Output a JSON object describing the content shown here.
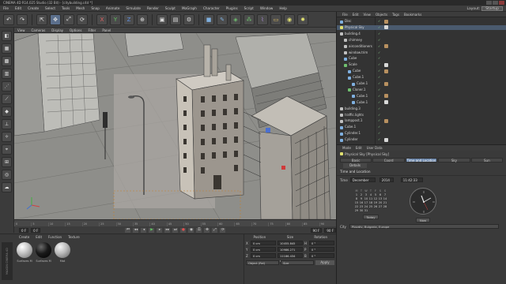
{
  "window": {
    "title": "CINEMA 4D R14.025 Studio (32 Bit) - [citybuilding.c4d *]"
  },
  "menubar": {
    "items": [
      "File",
      "Edit",
      "Create",
      "Select",
      "Tools",
      "Mesh",
      "Snap",
      "Animate",
      "Simulate",
      "Render",
      "Sculpt",
      "MoGraph",
      "Character",
      "Plugins",
      "Script",
      "Window",
      "Help"
    ],
    "layout_label": "Layout:",
    "layout_value": "Startup"
  },
  "viewport": {
    "menu": [
      "View",
      "Cameras",
      "Display",
      "Options",
      "Filter",
      "Panel"
    ]
  },
  "timeline": {
    "ticks": [
      "0",
      "5",
      "10",
      "15",
      "20",
      "25",
      "30",
      "35",
      "40",
      "45",
      "50",
      "55",
      "60",
      "65",
      "70",
      "75",
      "80",
      "85",
      "90"
    ]
  },
  "playbar": {
    "start": "0 F",
    "current": "0 F",
    "end": "90 F",
    "end2": "90 F"
  },
  "material_manager": {
    "menu": [
      "Create",
      "Edit",
      "Function",
      "Texture"
    ],
    "materials": [
      {
        "label": "Surfaces M"
      },
      {
        "label": "Surfaces M"
      },
      {
        "label": "Mat"
      }
    ],
    "brand": "MAXON CINEMA 4D"
  },
  "coord_manager": {
    "headers": [
      "Position",
      "Size",
      "Rotation"
    ],
    "rows": [
      {
        "axis": "X",
        "pos": "0 cm",
        "size": "0 cm",
        "rot": "0 °",
        "size_alt": "10455.845 cm",
        "rot_label": "H"
      },
      {
        "axis": "Y",
        "pos": "0 cm",
        "size": "0 cm",
        "rot": "0 °",
        "size_alt": "10986.271 cm",
        "rot_label": "P"
      },
      {
        "axis": "Z",
        "pos": "0 cm",
        "size": "0 cm",
        "rot": "0 °",
        "size_alt": "11186.434 cm",
        "rot_label": "B"
      }
    ],
    "mode_value": "Object (Rel)",
    "size_mode": "Size",
    "apply_label": "Apply"
  },
  "object_manager": {
    "menu": [
      "File",
      "Edit",
      "View",
      "Objects",
      "Tags",
      "Bookmarks"
    ],
    "rows": [
      {
        "name": "Disc",
        "depth": 0,
        "color": "#7fb0e0",
        "selected": false
      },
      {
        "name": "Physical Sky",
        "depth": 0,
        "color": "#e0e070",
        "selected": true
      },
      {
        "name": "building.4",
        "depth": 0,
        "color": "#c0c0c0",
        "selected": false
      },
      {
        "name": "chimney",
        "depth": 1,
        "color": "#c0c0c0",
        "selected": false
      },
      {
        "name": "airconditioners",
        "depth": 1,
        "color": "#c0c0c0",
        "selected": false
      },
      {
        "name": "window.trim",
        "depth": 1,
        "color": "#c0c0c0",
        "selected": false
      },
      {
        "name": "Cube",
        "depth": 1,
        "color": "#7fb0e0",
        "selected": false
      },
      {
        "name": "Scale",
        "depth": 1,
        "color": "#6fc06f",
        "selected": false
      },
      {
        "name": "Cube",
        "depth": 2,
        "color": "#7fb0e0",
        "selected": false
      },
      {
        "name": "Cube.1",
        "depth": 2,
        "color": "#7fb0e0",
        "selected": false
      },
      {
        "name": "Cube.1",
        "depth": 3,
        "color": "#7fb0e0",
        "selected": false
      },
      {
        "name": "Cloner.1",
        "depth": 2,
        "color": "#6fc06f",
        "selected": false
      },
      {
        "name": "Cube.1",
        "depth": 3,
        "color": "#7fb0e0",
        "selected": false
      },
      {
        "name": "Cube.1",
        "depth": 3,
        "color": "#7fb0e0",
        "selected": false
      },
      {
        "name": "building.3",
        "depth": 0,
        "color": "#c0c0c0",
        "selected": false
      },
      {
        "name": "traffic.lights",
        "depth": 0,
        "color": "#c0c0c0",
        "selected": false
      },
      {
        "name": "lamppost.1",
        "depth": 0,
        "color": "#c0c0c0",
        "selected": false
      },
      {
        "name": "Cube.1",
        "depth": 0,
        "color": "#7fb0e0",
        "selected": false
      },
      {
        "name": "Cylinder.1",
        "depth": 0,
        "color": "#7fb0e0",
        "selected": false
      },
      {
        "name": "Cylinder",
        "depth": 0,
        "color": "#7fb0e0",
        "selected": false
      }
    ]
  },
  "attr_manager": {
    "menu": [
      "Mode",
      "Edit",
      "User Data"
    ],
    "object_label": "Physical Sky [Physical Sky]",
    "tabs_row1": [
      "Basic",
      "Coord",
      "Time and Location",
      "Sky",
      "Sun"
    ],
    "tabs_row2": [
      "Details"
    ],
    "active_tab": "Time and Location",
    "section_title": "Time and Location",
    "time_label": "Time",
    "month": "December",
    "year": "2014",
    "clock_value": "11:42:33",
    "calendar_head": [
      "M",
      "T",
      "W",
      "T",
      "F",
      "S",
      "S"
    ],
    "calendar_rows": [
      [
        "1",
        "2",
        "3",
        "4",
        "5",
        "6",
        "7"
      ],
      [
        "8",
        "9",
        "10",
        "11",
        "12",
        "13",
        "14"
      ],
      [
        "15",
        "16",
        "17",
        "18",
        "19",
        "20",
        "21"
      ],
      [
        "22",
        "23",
        "24",
        "25",
        "26",
        "27",
        "28"
      ],
      [
        "29",
        "30",
        "31",
        "",
        "",
        "",
        ""
      ]
    ],
    "today_button": "Today",
    "now_button": "Now",
    "city_label": "City",
    "city_value": "Plovdiv, Bulgaria, Europe"
  }
}
